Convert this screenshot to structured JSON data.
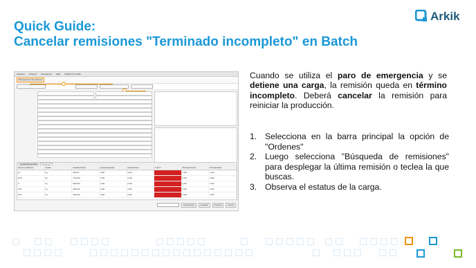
{
  "title": {
    "line1": "Quick Guide:",
    "line2": "Cancelar remisiones \"Terminado incompleto\" en Batch"
  },
  "logo": {
    "text": "Arkik",
    "icon": "arkik-logo-icon",
    "color": "#1e5b7a",
    "accent": "#1a98d5"
  },
  "intro": {
    "t1": "Cuando se utiliza el ",
    "b1": "paro de emergencia",
    "t2": " y se ",
    "b2": "detiene una carga",
    "t3": ", la remisión queda en ",
    "b3": "término incompleto",
    "t4": ". Deberá ",
    "b4": "cancelar",
    "t5": " la remisión para reiniciar la producción."
  },
  "steps": [
    {
      "num": "1.",
      "text": "Selecciona en la barra principal la opción de \"Ordenes\""
    },
    {
      "num": "2.",
      "text": "Luego selecciona \"Búsqueda de remisiones\" para desplegar la última remisión o teclea la que buscas."
    },
    {
      "num": "3.",
      "text": "Observa el estatus de la carga."
    }
  ],
  "screenshot": {
    "menu": [
      "Usuarios",
      "Órdenes",
      "Remisiones",
      "HPE",
      "MSSP V2 (T-009)"
    ],
    "toolbar": [
      "Búsqueda de Remisiones"
    ],
    "grid_tabs": [
      "Composición por Silos",
      "Producción"
    ],
    "grid_columns": [
      "Número de Material",
      "Unidad",
      "Cantidad Teórica",
      "Cantidad Ajustada",
      "Cantidad Real",
      "% Error",
      "Humedad Teórica",
      "Humedad Real"
    ],
    "grid_rows": [
      [
        "AF",
        "Kg",
        "3400.00",
        "0.000",
        "0.000",
        "",
        "0.000",
        "0.000"
      ],
      [
        "AF70",
        "Kg",
        "7700.000",
        "0.000",
        "0.000",
        "",
        "0.000",
        "0.000"
      ],
      [
        "H",
        "Kg",
        "2900.000",
        "0.000",
        "0.000",
        "",
        "0.000",
        "0.000"
      ],
      [
        "CPO",
        "Kg",
        "3300.000",
        "0.000",
        "0.000",
        "",
        "0.000",
        "0.000"
      ],
      [
        "SILO",
        "Kg",
        "3100.000",
        "0.000",
        "0.000",
        "",
        "0.000",
        "0.000"
      ]
    ],
    "bottom_buttons": [
      "Carta Porte",
      "Guardar",
      "Imprimir",
      "Cerrar"
    ],
    "error_color": "#d42020",
    "highlight_color": "#f39200"
  },
  "colors": {
    "title": "#1a98d5",
    "deco_light": "#dbe9f5",
    "deco_orange": "#f39200",
    "deco_blue": "#1a98d5",
    "deco_green": "#7ab929"
  }
}
